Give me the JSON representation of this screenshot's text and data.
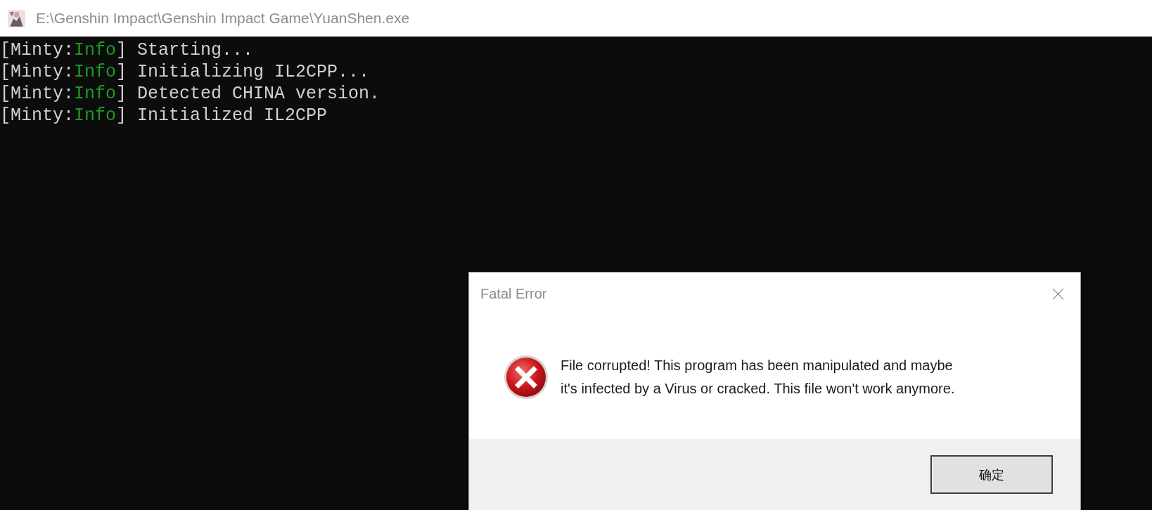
{
  "window": {
    "title": "E:\\Genshin Impact\\Genshin Impact Game\\YuanShen.exe"
  },
  "console": {
    "lines": [
      {
        "prefix": "[Minty:",
        "level": "Info",
        "suffix": "]",
        "message": "Starting..."
      },
      {
        "prefix": "[Minty:",
        "level": "Info",
        "suffix": "]",
        "message": "Initializing IL2CPP..."
      },
      {
        "prefix": "[Minty:",
        "level": "Info",
        "suffix": "]",
        "message": "Detected CHINA version."
      },
      {
        "prefix": "[Minty:",
        "level": "Info",
        "suffix": "]",
        "message": "Initialized IL2CPP"
      }
    ]
  },
  "dialog": {
    "title": "Fatal Error",
    "message": "File corrupted! This program has been manipulated and maybe\nit's infected by a Virus or cracked. This file won't work anymore.",
    "buttons": [
      {
        "label": "确定"
      }
    ]
  }
}
